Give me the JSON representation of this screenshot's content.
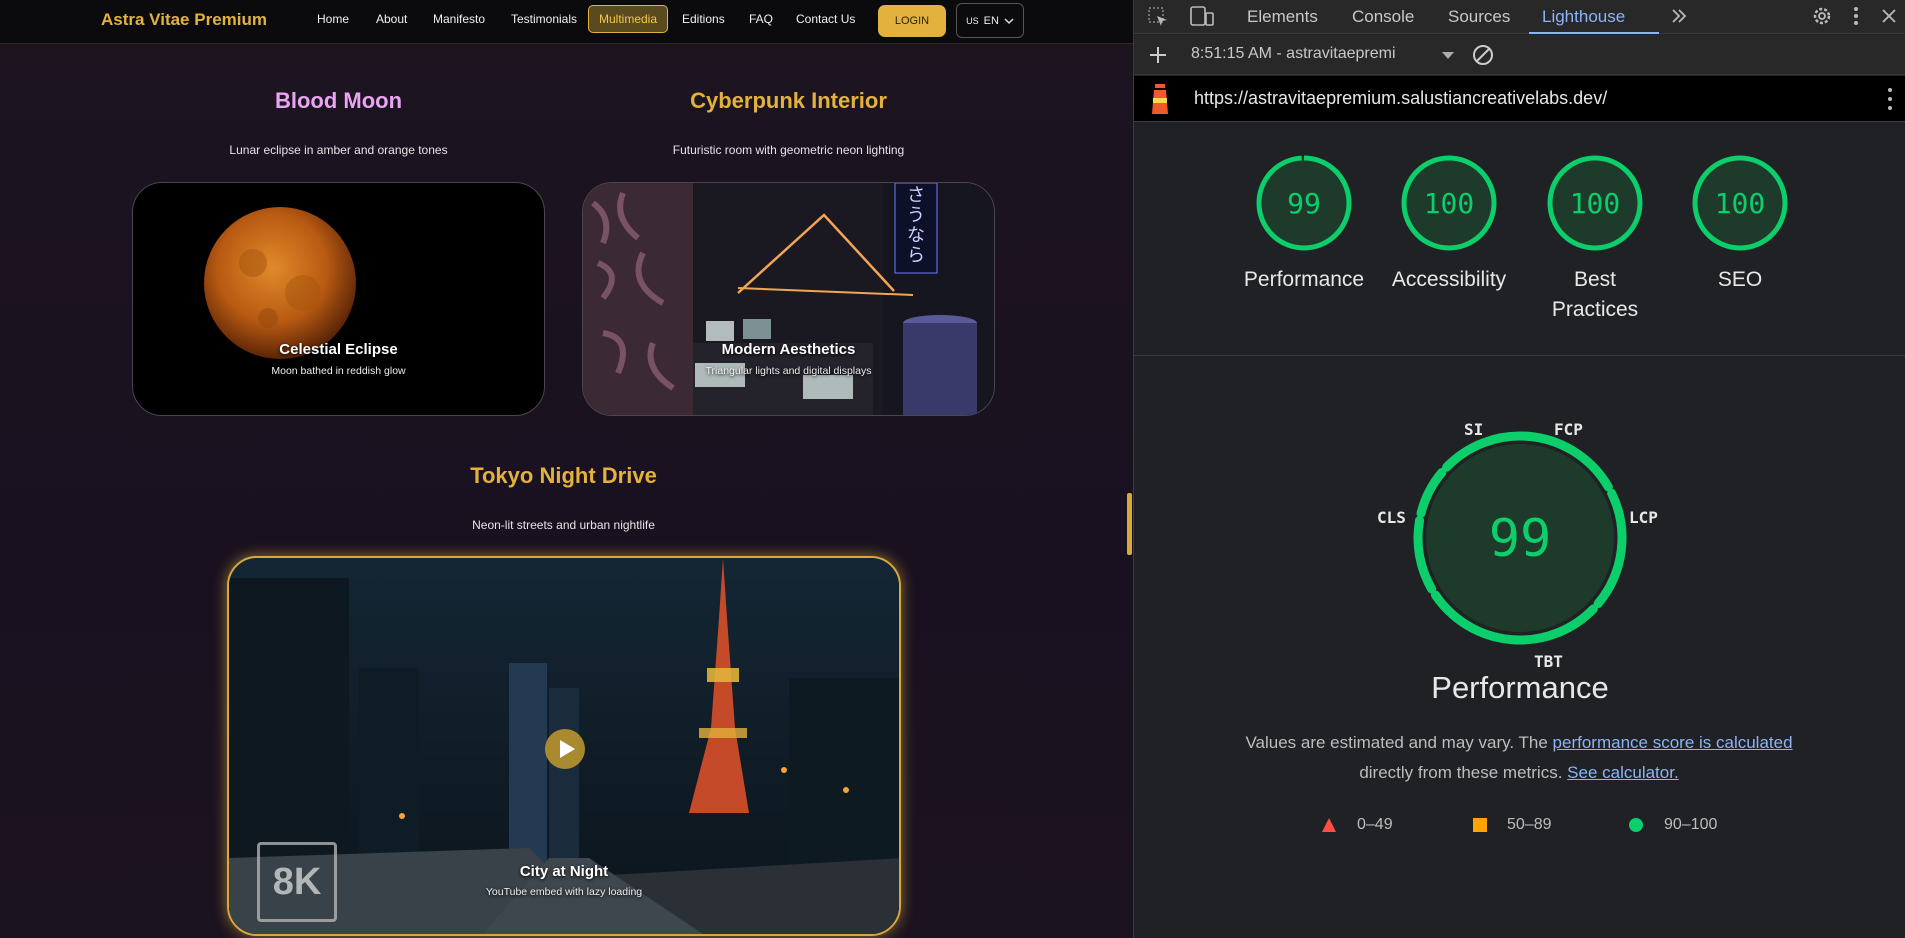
{
  "nav": {
    "brand": "Astra Vitae Premium",
    "links": [
      "Home",
      "About",
      "Manifesto",
      "Testimonials",
      "Multimedia",
      "Editions",
      "FAQ",
      "Contact Us"
    ],
    "login": "LOGIN",
    "lang_flag": "US",
    "lang": "EN"
  },
  "gallery": {
    "blood_moon": {
      "title": "Blood Moon",
      "subtitle": "Lunar eclipse in amber and orange tones",
      "card_title": "Celestial Eclipse",
      "card_sub": "Moon bathed in reddish glow"
    },
    "cyberpunk": {
      "title": "Cyberpunk Interior",
      "subtitle": "Futuristic room with geometric neon lighting",
      "card_title": "Modern Aesthetics",
      "card_sub": "Triangular lights and digital displays",
      "neon_sign": "さうなら"
    },
    "tokyo": {
      "title": "Tokyo Night Drive",
      "subtitle": "Neon-lit streets and urban nightlife",
      "card_title": "City at Night",
      "card_sub": "YouTube embed with lazy loading",
      "badge": "8K"
    }
  },
  "devtools": {
    "tabs": [
      "Elements",
      "Console",
      "Sources",
      "Lighthouse"
    ],
    "active_tab": "Lighthouse",
    "report_time": "8:51:15 AM - astravitaepremi",
    "url": "https://astravitaepremium.salustiancreativelabs.dev/",
    "scores": [
      {
        "value": "99",
        "label": "Performance"
      },
      {
        "value": "100",
        "label": "Accessibility"
      },
      {
        "value": "100",
        "label": "Best Practices"
      },
      {
        "value": "100",
        "label": "SEO"
      }
    ],
    "perf_score": "99",
    "perf_title": "Performance",
    "metrics": {
      "si": "SI",
      "fcp": "FCP",
      "lcp": "LCP",
      "tbt": "TBT",
      "cls": "CLS"
    },
    "note_prefix": "Values are estimated and may vary. The ",
    "note_link1": "performance score is calculated",
    "note_middle": "directly from these metrics.",
    "note_link2": "See calculator.",
    "legend": [
      "0–49",
      "50–89",
      "90–100"
    ],
    "colors": {
      "pass": "#0cce6b",
      "average": "#ffa400",
      "fail": "#ff4e42",
      "accent": "#e3b23c"
    }
  }
}
